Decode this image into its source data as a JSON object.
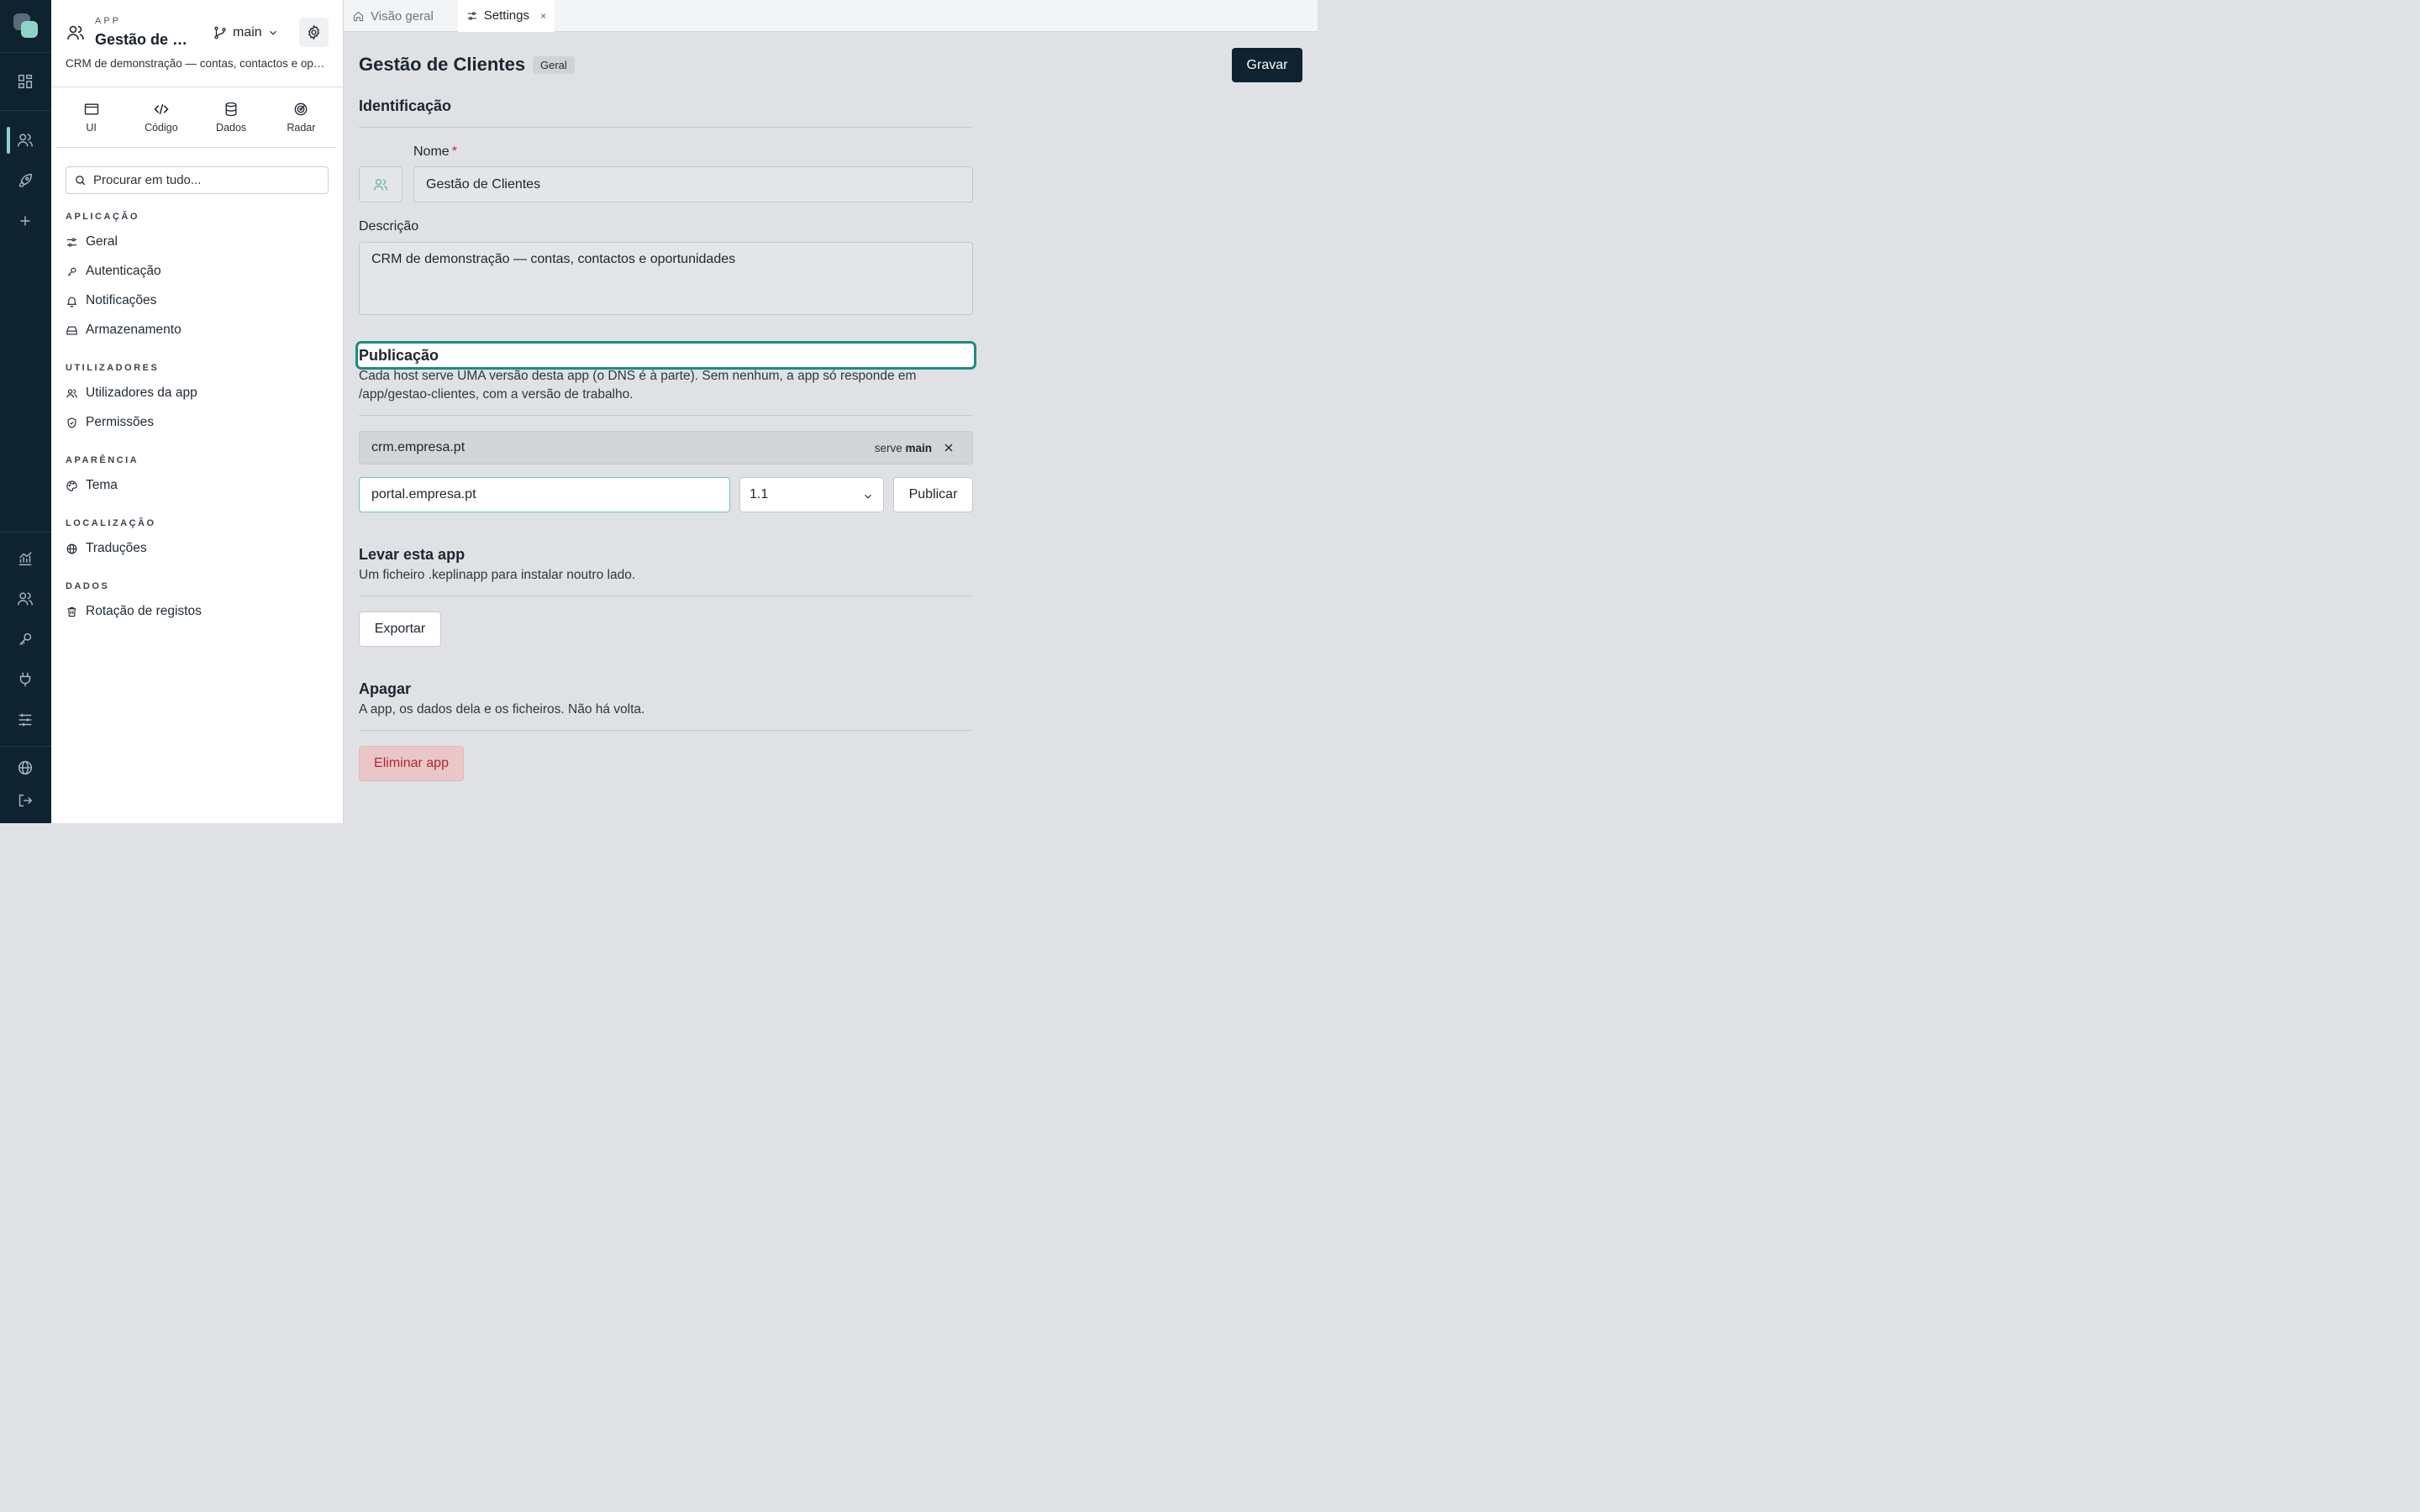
{
  "rail": {
    "icons": [
      "dashboard-icon",
      "users-icon",
      "rocket-icon",
      "plus-icon",
      "chart-icon",
      "team-icon",
      "key-icon",
      "plug-icon",
      "sliders-icon",
      "globe-icon",
      "logout-icon"
    ],
    "accent": "#8fd3c6"
  },
  "app": {
    "kicker": "APP",
    "name": "Gestão de Clientes",
    "branch": "main",
    "description": "CRM de demonstração — contas, contactos e oportunidades"
  },
  "modes": [
    {
      "label": "UI",
      "icon": "window-icon"
    },
    {
      "label": "Código",
      "icon": "code-icon"
    },
    {
      "label": "Dados",
      "icon": "database-icon"
    },
    {
      "label": "Radar",
      "icon": "radar-icon"
    }
  ],
  "search": {
    "placeholder": "Procurar em tudo..."
  },
  "nav": {
    "groups": [
      {
        "label": "APLICAÇÃO",
        "items": [
          "Geral",
          "Autenticação",
          "Notificações",
          "Armazenamento"
        ]
      },
      {
        "label": "UTILIZADORES",
        "items": [
          "Utilizadores da app",
          "Permissões"
        ]
      },
      {
        "label": "APARÊNCIA",
        "items": [
          "Tema"
        ]
      },
      {
        "label": "LOCALIZAÇÃO",
        "items": [
          "Traduções"
        ]
      },
      {
        "label": "DADOS",
        "items": [
          "Rotação de registos"
        ]
      }
    ]
  },
  "tabs": [
    {
      "label": "Visão geral",
      "active": false
    },
    {
      "label": "Settings",
      "active": true,
      "close": "×"
    }
  ],
  "page": {
    "title": "Gestão de Clientes",
    "badge": "Geral",
    "save_label": "Gravar"
  },
  "identification": {
    "title": "Identificação",
    "name_label": "Nome",
    "required_mark": "*",
    "name_value": "Gestão de Clientes",
    "description_label": "Descrição",
    "description_value": "CRM de demonstração — contas, contactos e oportunidades"
  },
  "publication": {
    "title": "Publicação",
    "subtitle": "Cada host serve UMA versão desta app (o DNS é à parte). Sem nenhum, a app só responde em /app/gestao-clientes, com a versão de trabalho.",
    "hosts": [
      {
        "host": "crm.empresa.pt",
        "serve_prefix": "serve",
        "serve_version": "main"
      }
    ],
    "new_host_value": "portal.empresa.pt",
    "version_value": "1.1",
    "publish_label": "Publicar",
    "focus_color": "#1a8c82"
  },
  "export": {
    "title": "Levar esta app",
    "subtitle": "Um ficheiro .keplinapp para instalar noutro lado.",
    "button_label": "Exportar"
  },
  "delete": {
    "title": "Apagar",
    "subtitle": "A app, os dados dela e os ficheiros. Não há volta.",
    "button_label": "Eliminar app",
    "danger_color": "#b4252b"
  }
}
